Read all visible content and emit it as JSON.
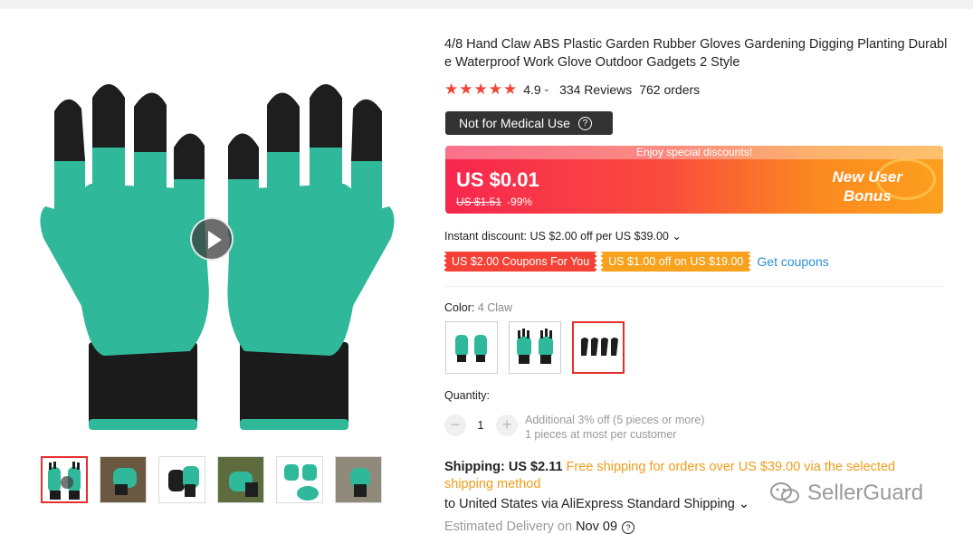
{
  "product": {
    "title": "4/8 Hand Claw ABS Plastic Garden Rubber Gloves Gardening Digging Planting Durabl e Waterproof Work Glove Outdoor Gadgets 2 Style",
    "rating": "4.9",
    "reviews": "334 Reviews",
    "orders": "762 orders",
    "stars": "★★★★★"
  },
  "badge": {
    "label": "Not for Medical Use",
    "help": "?"
  },
  "promo": {
    "strip": "Enjoy special discounts!",
    "price": "US $0.01",
    "original": "US $1.51",
    "discount": "-99%",
    "label_line1": "New User",
    "label_line2": "Bonus"
  },
  "instant_discount": "Instant discount: US $2.00 off per US $39.00 ⌄",
  "coupons": [
    "US $2.00 Coupons For You",
    "US $1.00 off on US $19.00"
  ],
  "get_coupons": "Get coupons",
  "color": {
    "label": "Color: ",
    "value": "4 Claw",
    "options": [
      "green-gloves",
      "claw-gloves",
      "black-claws"
    ],
    "selected_index": 2
  },
  "quantity": {
    "label": "Quantity:",
    "value": "1",
    "minus": "−",
    "plus": "+",
    "note1": "Additional 3% off (5 pieces or more)",
    "note2": "1 pieces at most per customer"
  },
  "shipping": {
    "label": "Shipping: US $2.11",
    "free_text": "Free shipping for orders over US $39.00 via the selected shipping method",
    "to": "to United States via AliExpress Standard Shipping ⌄",
    "delivery_label": "Estimated Delivery on ",
    "delivery_date": "Nov 09",
    "help": "?"
  },
  "watermark": "SellerGuard",
  "colors": {
    "accent_red": "#e62e2e",
    "glove_green": "#2fb89a",
    "claw_black": "#1e1e1e",
    "link_blue": "#2a8fd6",
    "orange": "#f29c19"
  }
}
